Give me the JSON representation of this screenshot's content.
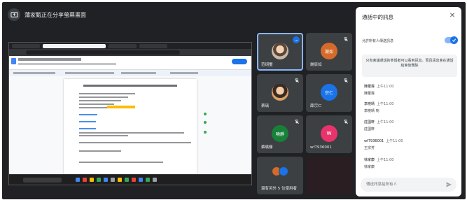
{
  "presentation": {
    "label": "蒲家甄正在分享螢幕畫面",
    "icon": "present-icon"
  },
  "participants": [
    {
      "name": "范翊璽",
      "avatar": "photo",
      "muted": false,
      "highlighted": true
    },
    {
      "name": "謝辰如",
      "avatar": "initial",
      "initial": "謝如",
      "color": "#d56b2a",
      "muted": true
    },
    {
      "name": "蔡璃",
      "avatar": "photo",
      "muted": true
    },
    {
      "name": "薛宗仁",
      "avatar": "initial",
      "initial": "宗仁",
      "color": "#1a73e8",
      "muted": true
    },
    {
      "name": "蔡曉靜",
      "avatar": "initial",
      "initial": "曉靜",
      "color": "#188038",
      "muted": true
    },
    {
      "name": "wf7936001",
      "avatar": "initial",
      "initial": "w",
      "color": "#e8336d",
      "muted": true
    },
    {
      "name": "還有另外 5 位使用者",
      "avatar": "pair",
      "muted": false
    }
  ],
  "chat": {
    "title": "通話中的訊息",
    "close_icon": "close-icon",
    "toggle_label": "允許所有人傳送訊息",
    "toggle_on": true,
    "notice": "只有會議通話的參與者可以看到訊息。而且訊息會在通話結束後刪除",
    "messages": [
      {
        "sender": "陳璽霖",
        "time": "上午11:00",
        "text": "陳璽霖"
      },
      {
        "sender": "李曉晴",
        "time": "上午11:00",
        "text": "李曉晴 到"
      },
      {
        "sender": "莊國軒",
        "time": "上午11:00",
        "text": "莊國軒"
      },
      {
        "sender": "wf7936001",
        "time": "上午11:00",
        "text": "王宗芳"
      },
      {
        "sender": "徐家康",
        "time": "上午11:00",
        "text": "徐家康"
      }
    ],
    "input_placeholder": "傳送訊息給所有人",
    "send_icon": "send-icon"
  },
  "colors": {
    "meet_bg": "#202124",
    "tile_bg": "#3c4043",
    "accent": "#1a73e8"
  }
}
